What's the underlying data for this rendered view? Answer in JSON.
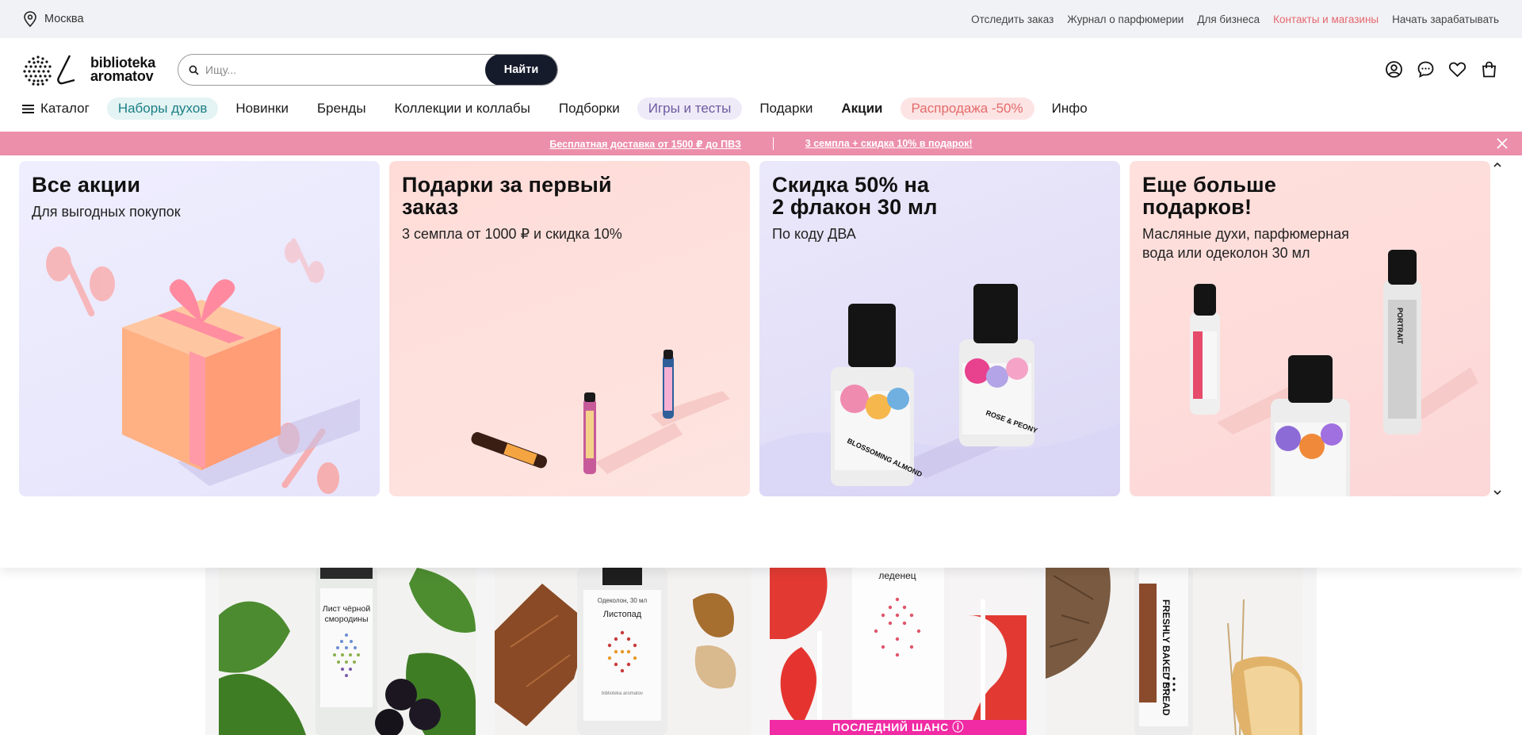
{
  "topbar": {
    "city": "Москва",
    "links": [
      "Отследить заказ",
      "Журнал о парфюмерии",
      "Для бизнеса",
      "Контакты и магазины",
      "Начать зарабатывать"
    ]
  },
  "header": {
    "logo_line1": "biblioteka",
    "logo_line2": "aromatov",
    "search_placeholder": "Ищу...",
    "search_button": "Найти"
  },
  "nav": {
    "catalog": "Каталог",
    "items": [
      "Наборы духов",
      "Новинки",
      "Бренды",
      "Коллекции и коллабы",
      "Подборки",
      "Игры и тесты",
      "Подарки",
      "Акции",
      "Распродажа -50%",
      "Инфо"
    ]
  },
  "promo": {
    "left": "Бесплатная доставка от 1500 ₽ до ПВЗ",
    "right": "3 семпла + скидка 10% в подарок!"
  },
  "cards": [
    {
      "title": "Все акции",
      "subtitle": "Для выгодных покупок"
    },
    {
      "title_line1": "Подарки за первый",
      "title_line2": "заказ",
      "subtitle": "3 семпла от 1000 ₽ и скидка 10%"
    },
    {
      "title_line1": "Скидка 50% на",
      "title_line2": "2 флакон 30 мл",
      "subtitle": "По коду ДВА",
      "label_a": "BLOSSOMING ALMOND",
      "label_b": "ROSE & PEONY"
    },
    {
      "title_line1": "Еще больше",
      "title_line2": "подарков!",
      "subtitle_line1": "Масляные духи, парфюмерная",
      "subtitle_line2": "вода или одеколон 30 мл",
      "label": "PORTRAIT"
    }
  ],
  "products": {
    "p1_label_line1": "Лист чёрной",
    "p1_label_line2": "смородины",
    "p2_top": "Одеколон, 30 мл",
    "p2_label": "Листопад",
    "p3_label": "леденец",
    "p3_badge": "ПОСЛЕДНИЙ ШАНС ⓘ",
    "p4_label": "FRESHLY BAKED BREAD"
  },
  "colors": {
    "accent_link": "#e6676f",
    "promo_bar": "#ec8fab",
    "search_button": "#161b2c",
    "badge": "#f02ba4"
  }
}
